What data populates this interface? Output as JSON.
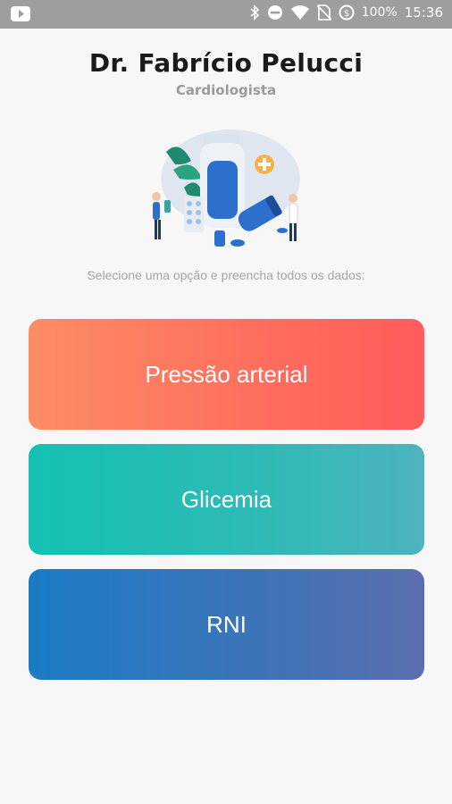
{
  "status_bar": {
    "battery": "100%",
    "time": "15:36",
    "icons": [
      "youtube-icon",
      "bluetooth-icon",
      "do-not-disturb-icon",
      "wifi-icon",
      "no-sim-icon",
      "data-saver-icon"
    ]
  },
  "header": {
    "title": "Dr. Fabrício Pelucci",
    "subtitle": "Cardiologista"
  },
  "illustration": {
    "name": "medicine-illustration"
  },
  "instruction": "Selecione uma opção e preencha todos os dados:",
  "options": [
    {
      "label": "Pressão arterial"
    },
    {
      "label": "Glicemia"
    },
    {
      "label": "RNI"
    }
  ],
  "colors": {
    "background": "#f7f7f7",
    "status_bar": "#9e9e9e",
    "option_1": [
      "#fc8d63",
      "#ff5c5c"
    ],
    "option_2": [
      "#14c0b2",
      "#4db3bf"
    ],
    "option_3": [
      "#1a7cc6",
      "#5b6fb0"
    ]
  }
}
